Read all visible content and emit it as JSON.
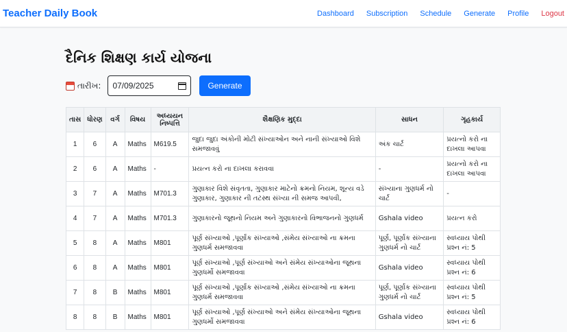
{
  "brand": "Teacher Daily Book",
  "nav": [
    "Dashboard",
    "Subscription",
    "Schedule",
    "Generate",
    "Profile",
    "Logout"
  ],
  "page_title": "દૈનિક શિક્ષણ કાર્ય યોજના",
  "date_label": "તારીખ:",
  "date_value": "07/09/2025",
  "generate_label": "Generate",
  "table": {
    "headers": [
      "તાસ",
      "ધોરણ",
      "વર્ગ",
      "વિષય",
      "અધ્યયન નિષ્પત્તિ",
      "શૈક્ષણિક મુદ્દા",
      "સાધન",
      "ગૃહકાર્ય"
    ],
    "rows": [
      [
        "1",
        "6",
        "A",
        "Maths",
        "M619.5",
        "જુદા જુદા અંકોની મોટી સંખ્યાઓન અને નાની સંખ્યાઓ વિશે સમજાવવું",
        "અંક ચાર્ટ",
        "પ્રયત્નો કરો ના દાખલા આપવા"
      ],
      [
        "2",
        "6",
        "A",
        "Maths",
        "-",
        "પ્રયત્ન કરો ના દાખલા કરાવવા",
        "-",
        "પ્રયત્નો કરો ના દાખલા આપવા"
      ],
      [
        "3",
        "7",
        "A",
        "Maths",
        "M701.3",
        "ગુણાકાર વિશે સંવૃતતા, ગુણાકાર માટેનો ક્રમનો નિયમ, શૂન્ય વડે ગુણાકાર, ગુણાકાર ની તટસ્થ સંખ્યા ની સમજ આપવી,",
        "સંખ્યાના ગુણધર્મ નો ચાર્ટ",
        "-"
      ],
      [
        "4",
        "7",
        "A",
        "Maths",
        "M701.3",
        "ગુણાકારનો જૂથનો નિયમ અને ગુણાકારનો વિભાજનનો ગુણધર્મ",
        "Gshala video",
        "પ્રયત્ન કરો"
      ],
      [
        "5",
        "8",
        "A",
        "Maths",
        "M801",
        "પૂર્ણ સંખ્યાઓ ,પૂર્ણાંક સંખ્યાઓ ,સંમેય સંખ્યાઓ ના ક્રમના ગુણધર્મ સમજાવવા",
        "પૂર્ણ, પૂર્ણાંક સંખ્યાના ગુણધર્મ નો ચાર્ટ",
        "સ્વધ્યાય પોથી પ્રશ્ન નં: 5"
      ],
      [
        "6",
        "8",
        "A",
        "Maths",
        "M801",
        "પૂર્ણ સંખ્યાઓ ,પૂર્ણ સંખ્યાઓ અને સંમેય સંખ્યાઓના જૂથના ગુણધર્મો સમજાવવા",
        "Gshala video",
        "સ્વધ્યાય પોથી પ્રશ્ન નં: 6"
      ],
      [
        "7",
        "8",
        "B",
        "Maths",
        "M801",
        "પૂર્ણ સંખ્યાઓ ,પૂર્ણાંક સંખ્યાઓ ,સંમેય સંખ્યાઓ ના ક્રમના ગુણધર્મ સમજાવવા",
        "પૂર્ણ, પૂર્ણાંક સંખ્યાના ગુણધર્મ નો ચાર્ટ",
        "સ્વધ્યાય પોથી પ્રશ્ન નં: 5"
      ],
      [
        "8",
        "8",
        "B",
        "Maths",
        "M801",
        "પૂર્ણ સંખ્યાઓ ,પૂર્ણ સંખ્યાઓ અને સંમેય સંખ્યાઓના જૂથના ગુણધર્મો સમજાવવા",
        "Gshala video",
        "સ્વધ્યાય પોથી પ્રશ્ન નં: 6"
      ]
    ]
  }
}
